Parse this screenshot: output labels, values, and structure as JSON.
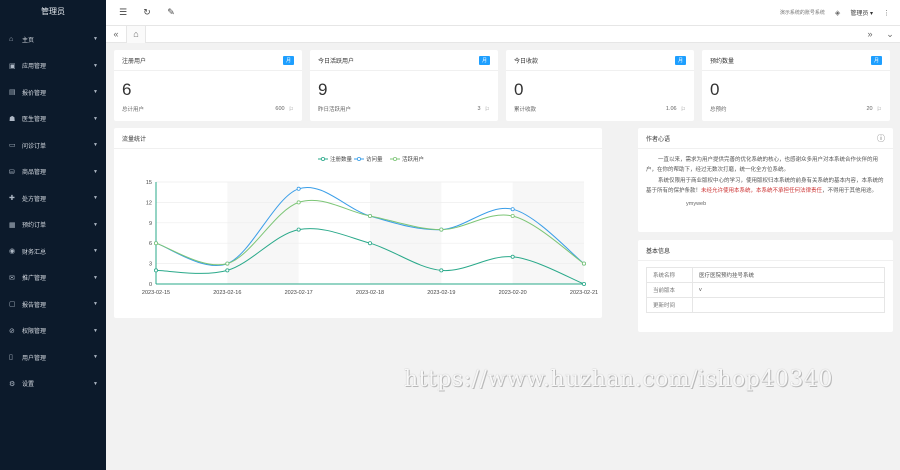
{
  "sidebar": {
    "title": "管理员",
    "items": [
      {
        "label": "主页",
        "icon": "home-icon",
        "glyph": "⌂"
      },
      {
        "label": "应用管理",
        "icon": "app-icon",
        "glyph": "▣"
      },
      {
        "label": "报价管理",
        "icon": "quote-icon",
        "glyph": "▤"
      },
      {
        "label": "医生管理",
        "icon": "doctor-icon",
        "glyph": "☗"
      },
      {
        "label": "问诊订单",
        "icon": "consult-icon",
        "glyph": "▭"
      },
      {
        "label": "商品管理",
        "icon": "goods-icon",
        "glyph": "⛁"
      },
      {
        "label": "处方管理",
        "icon": "prescription-icon",
        "glyph": "✚"
      },
      {
        "label": "预约订单",
        "icon": "appointment-icon",
        "glyph": "▦"
      },
      {
        "label": "财务汇总",
        "icon": "finance-icon",
        "glyph": "◉"
      },
      {
        "label": "推广管理",
        "icon": "promo-icon",
        "glyph": "✉"
      },
      {
        "label": "报告管理",
        "icon": "report-icon",
        "glyph": "▢"
      },
      {
        "label": "权限管理",
        "icon": "permission-icon",
        "glyph": "⊘"
      },
      {
        "label": "用户管理",
        "icon": "user-icon",
        "glyph": "▯"
      },
      {
        "label": "设置",
        "icon": "settings-icon",
        "glyph": "⚙"
      }
    ]
  },
  "topbar": {
    "menu_icon": "☰",
    "refresh_icon": "↻",
    "clean_icon": "✎",
    "link_text": "演示系统的账号系统",
    "theme_icon": "◈",
    "admin_label": "管理员 ▾",
    "more_icon": "⋮"
  },
  "tabbar": {
    "left_icon": "«",
    "home_icon": "⌂",
    "right_icon": "»",
    "down_icon": "⌄"
  },
  "stats": [
    {
      "title": "注册用户",
      "badge": "月",
      "value": "6",
      "foot_label": "总计用户",
      "foot_value": "600",
      "foot_icon": "⚐"
    },
    {
      "title": "今日活跃用户",
      "badge": "月",
      "value": "9",
      "foot_label": "昨日活跃用户",
      "foot_value": "3",
      "foot_icon": "⚐"
    },
    {
      "title": "今日收款",
      "badge": "月",
      "value": "0",
      "foot_label": "累计收款",
      "foot_value": "1.06",
      "foot_icon": "⚐"
    },
    {
      "title": "预约数量",
      "badge": "月",
      "value": "0",
      "foot_label": "总预约",
      "foot_value": "20",
      "foot_icon": "⚐"
    }
  ],
  "chart_panel": {
    "title": "流量统计"
  },
  "author": {
    "title": "作者心语",
    "info_icon": "ⓘ",
    "para1": "一直以来，需求为用户提供完善的优化系统的核心，也感谢众多用户对本系统合作伙伴的用户，在你的帮助下，经过无数次打磨，统一化全方位系统。",
    "para2": "系统仅限用于商业版权中心的学习，使用版权归本系统的前身有关系统的基本内容，本系统的基于所有的保护条款！",
    "para2_red": "未经允许使用本系统，本系统不承担任何法律责任",
    "para2_tail": "，不得用于其他用途。",
    "signature": "ymyweb"
  },
  "system": {
    "title": "基本信息",
    "rows": [
      {
        "key": "系统名称",
        "value": "医疗医院预约挂号系统"
      },
      {
        "key": "当前版本",
        "value": "v"
      },
      {
        "key": "更新时间",
        "value": ""
      }
    ]
  },
  "watermark": "https://www.huzhan.com/ishop40340",
  "colors": {
    "sidebar_bg": "#0c1a2b",
    "accent": "#1e9fff",
    "series_teal": "#2aa98a",
    "series_blue": "#3a9ee8",
    "series_green": "#7cc576"
  },
  "chart_data": {
    "type": "line",
    "title": "",
    "xlabel": "",
    "ylabel": "",
    "categories": [
      "2023-02-15",
      "2023-02-16",
      "2023-02-17",
      "2023-02-18",
      "2023-02-19",
      "2023-02-20",
      "2023-02-21"
    ],
    "ylim": [
      0,
      15
    ],
    "yticks": [
      0,
      3,
      6,
      9,
      12,
      15
    ],
    "legend_position": "top-center",
    "series": [
      {
        "name": "注册数量",
        "color": "#2aa98a",
        "values": [
          2,
          2,
          8,
          6,
          2,
          4,
          0
        ]
      },
      {
        "name": "访问量",
        "color": "#3a9ee8",
        "values": [
          6,
          3,
          14,
          10,
          8,
          11,
          3
        ]
      },
      {
        "name": "活跃用户",
        "color": "#7cc576",
        "values": [
          6,
          3,
          12,
          10,
          8,
          10,
          3
        ]
      }
    ]
  }
}
